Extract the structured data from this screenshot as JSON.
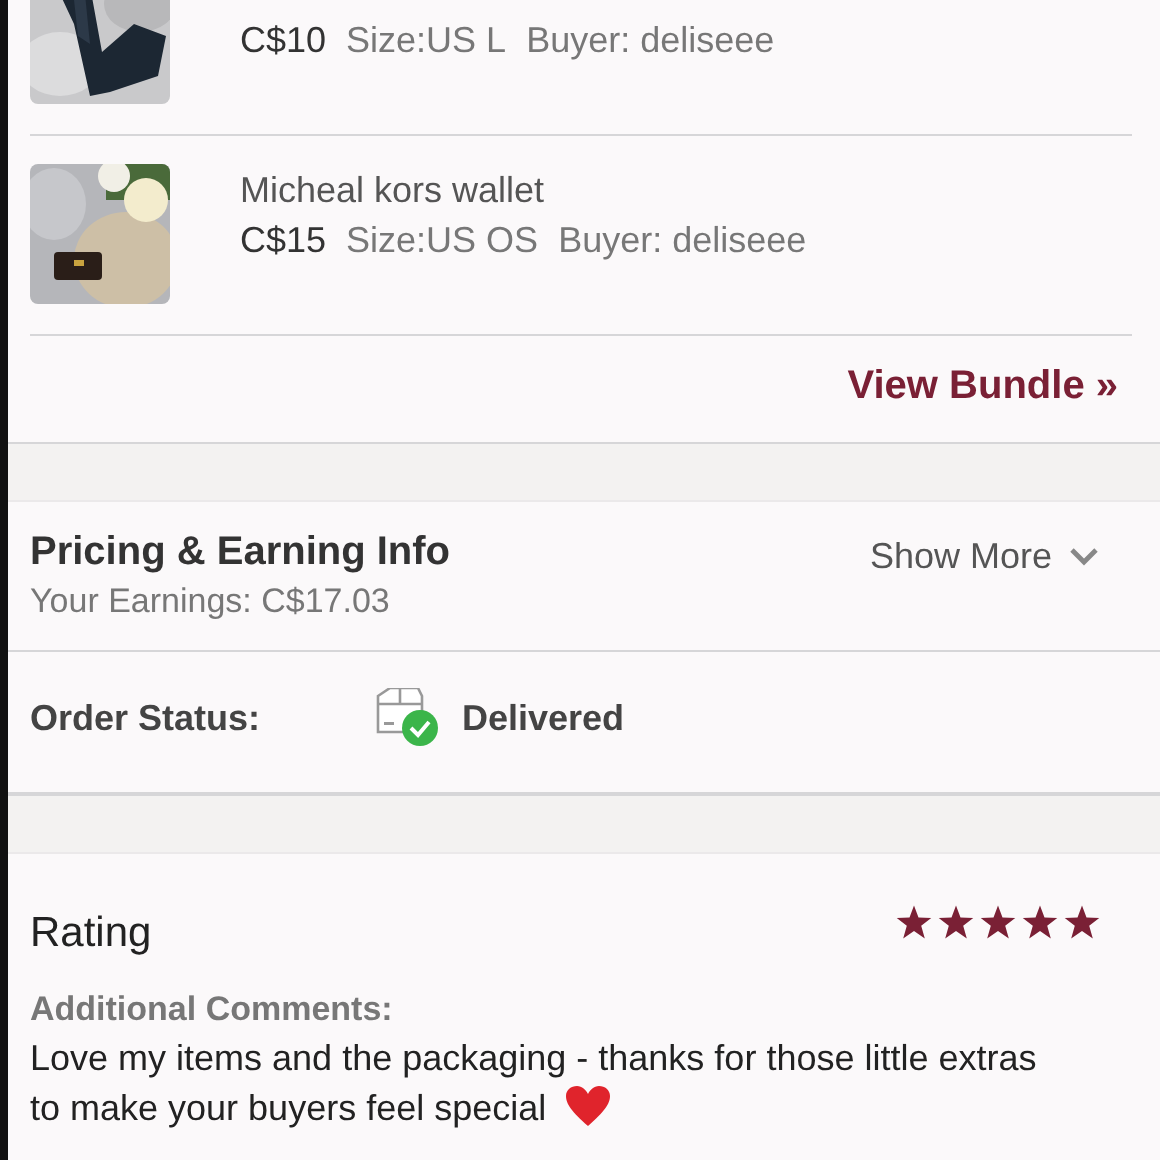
{
  "items": [
    {
      "kind": "leggings",
      "price": "C$10",
      "size": "Size:US L",
      "buyer": "Buyer: deliseee"
    },
    {
      "kind": "wallet",
      "title": "Micheal kors wallet",
      "price": "C$15",
      "size": "Size:US OS",
      "buyer": "Buyer: deliseee"
    }
  ],
  "view_bundle": "View Bundle »",
  "pricing": {
    "title": "Pricing & Earning Info",
    "earnings": "Your Earnings: C$17.03",
    "toggle": "Show More"
  },
  "order_status": {
    "label": "Order Status:",
    "value": "Delivered"
  },
  "rating": {
    "title": "Rating",
    "stars": 5,
    "comments_label": "Additional Comments:",
    "comment_lines": [
      "Love my items and the packaging - thanks for those little extras",
      "to make your buyers feel special"
    ]
  }
}
